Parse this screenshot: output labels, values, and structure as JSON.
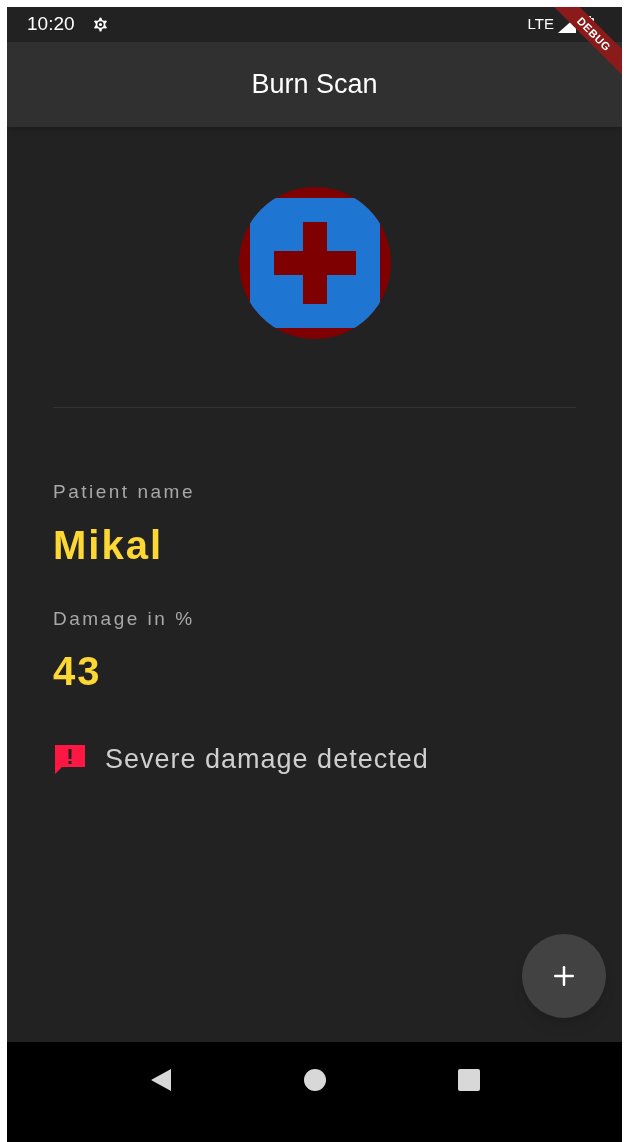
{
  "status_bar": {
    "time": "10:20",
    "network": "LTE"
  },
  "debug_banner": "DEBUG",
  "app_bar": {
    "title": "Burn Scan"
  },
  "patient": {
    "name_label": "Patient name",
    "name": "Mikal",
    "damage_label": "Damage in %",
    "damage": "43"
  },
  "alert": {
    "text": "Severe damage detected"
  }
}
